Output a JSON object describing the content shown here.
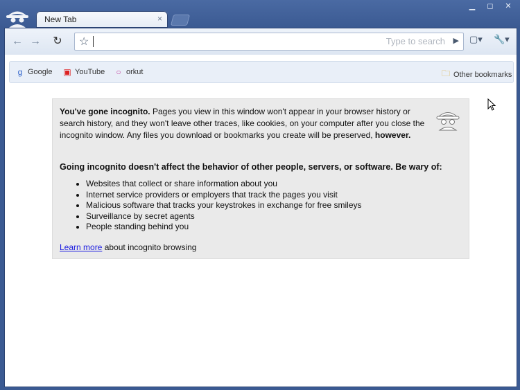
{
  "tab": {
    "title": "New Tab"
  },
  "window_controls": {
    "minimize": "▁",
    "maximize": "◻",
    "close": "✕"
  },
  "toolbar": {
    "omnibox_value": "",
    "omnibox_hint": "Type to search",
    "back_icon": "back-arrow-icon",
    "forward_icon": "forward-arrow-icon",
    "reload_icon": "reload-icon"
  },
  "bookmarks": [
    {
      "label": "Google",
      "icon": "google-icon"
    },
    {
      "label": "YouTube",
      "icon": "youtube-icon"
    },
    {
      "label": "orkut",
      "icon": "orkut-icon"
    }
  ],
  "other_bookmarks": "Other bookmarks",
  "incognito": {
    "title": "You've gone incognito.",
    "intro": "Pages you view in this window won't appear in your browser history or search history, and they won't leave other traces, like cookies, on your computer after you close the incognito window. Any files you download or bookmarks you create will be preserved,",
    "however": "however.",
    "heading": "Going incognito doesn't affect the behavior of other people, servers, or software. Be wary of:",
    "items": [
      "Websites that collect or share information about you",
      "Internet service providers or employers that track the pages you visit",
      "Malicious software that tracks your keystrokes in exchange for free smileys",
      "Surveillance by secret agents",
      "People standing behind you"
    ],
    "learn_more": "Learn more",
    "learn_more_suffix": "about incognito browsing"
  },
  "colors": {
    "frame": "#3b5a92",
    "panel": "#eaeaea",
    "link": "#1a1ae0"
  }
}
